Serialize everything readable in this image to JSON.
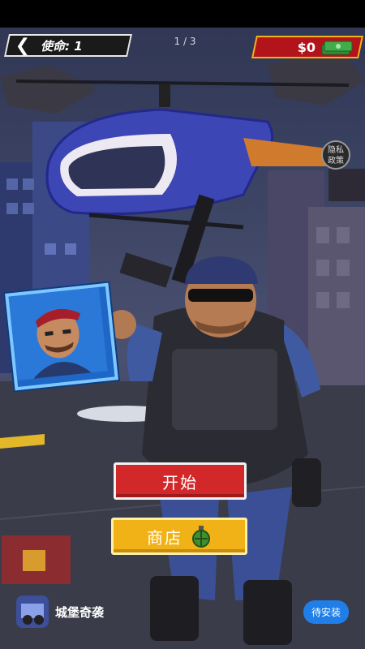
{
  "header": {
    "mission_label": "使命: 1",
    "back_icon": "chevron-left-icon",
    "pager": "1 / 3"
  },
  "wallet": {
    "amount": "$0",
    "icon": "cash-stack-icon"
  },
  "privacy": {
    "line1": "隐私",
    "line2": "政策"
  },
  "buttons": {
    "start_label": "开始",
    "shop_label": "商店",
    "shop_icon": "grenade-icon"
  },
  "ad": {
    "title": "城堡奇袭",
    "install_label": "待安装"
  },
  "colors": {
    "start": "#d3282a",
    "shop": "#f0b217",
    "money_bg": "#b3141c",
    "install": "#1f7ee8"
  }
}
